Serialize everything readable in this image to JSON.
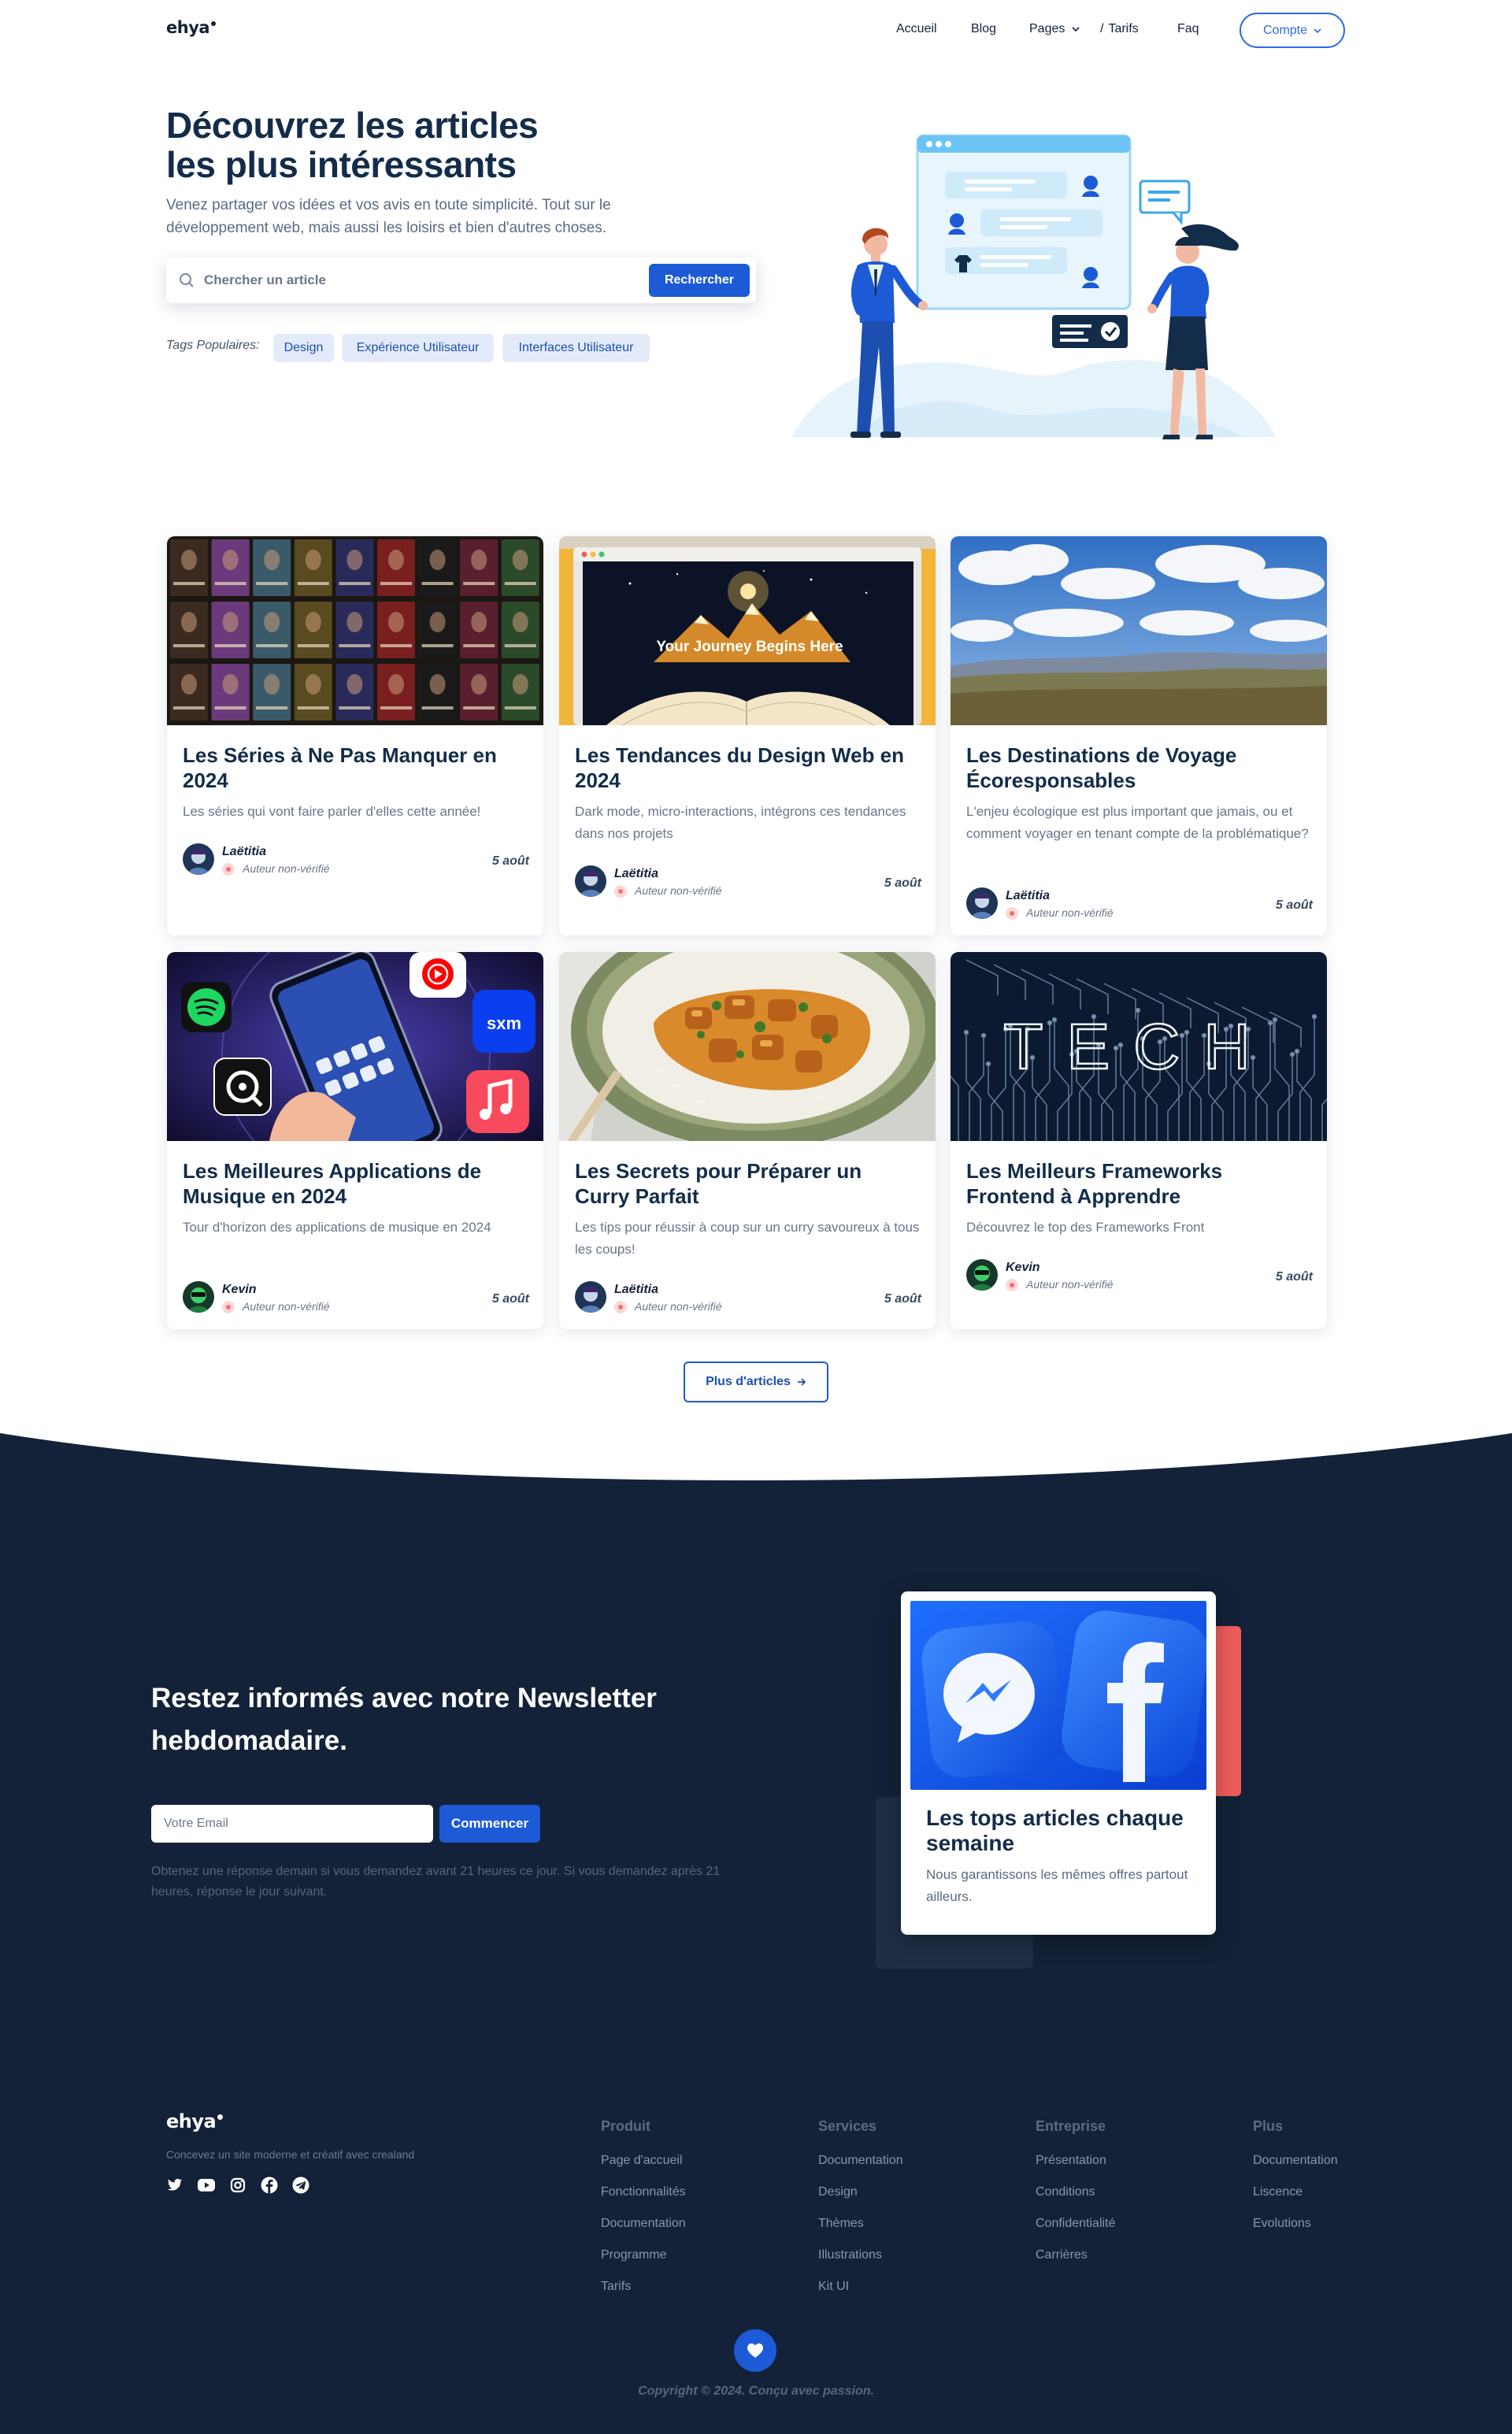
{
  "brand": {
    "name": "ehya"
  },
  "nav": {
    "links": [
      "Accueil",
      "Blog",
      "Pages",
      "Tarifs",
      "Faq"
    ],
    "account_label": "Compte"
  },
  "hero": {
    "title_line1": "Découvrez les articles",
    "title_line2": "les plus intéressants",
    "subtitle": "Venez partager vos idées et vos avis en toute simplicité. Tout sur le développement web, mais aussi les loisirs et bien d'autres choses.",
    "search_placeholder": "Chercher un article",
    "search_button": "Rechercher",
    "tags_label": "Tags Populaires:",
    "tags": [
      "Design",
      "Expérience Utilisateur",
      "Interfaces Utilisateur"
    ]
  },
  "articles": [
    {
      "title": "Les Séries à Ne Pas Manquer en 2024",
      "description": "Les séries qui vont faire parler d'elles cette année!",
      "author": "Laëtitia",
      "author_status": "Auteur non-vérifié",
      "date": "5 août",
      "image": "tv-series-posters"
    },
    {
      "title": "Les Tendances du Design Web en 2024",
      "description": "Dark mode, micro-interactions, intégrons ces tendances dans nos projets",
      "author": "Laëtitia",
      "author_status": "Auteur non-vérifié",
      "date": "5 août",
      "image": "browser-book-mountain",
      "image_caption": "Your Journey Begins Here"
    },
    {
      "title": "Les Destinations de Voyage Écoresponsables",
      "description": "L'enjeu écologique est plus important que jamais, ou et comment voyager en tenant compte de la problématique?",
      "author": "Laëtitia",
      "author_status": "Auteur non-vérifié",
      "date": "5 août",
      "image": "cloudy-landscape"
    },
    {
      "title": "Les Meilleures Applications de Musique en 2024",
      "description": "Tour d'horizon des applications de musique en 2024",
      "author": "Kevin",
      "author_status": "Auteur non-vérifié",
      "date": "5 août",
      "image": "phone-music-apps"
    },
    {
      "title": "Les Secrets pour Préparer un Curry Parfait",
      "description": "Les tips pour réussir à coup sur un curry savoureux à tous les coups!",
      "author": "Laëtitia",
      "author_status": "Auteur non-vérifié",
      "date": "5 août",
      "image": "curry-bowl"
    },
    {
      "title": "Les Meilleurs Frameworks Frontend à Apprendre",
      "description": "Découvrez le top des Frameworks Front",
      "author": "Kevin",
      "author_status": "Auteur non-vérifié",
      "date": "5 août",
      "image": "circuit-board",
      "image_caption": "TECH"
    }
  ],
  "more_button": "Plus d'articles",
  "newsletter": {
    "title": "Restez informés avec notre Newsletter hebdomadaire.",
    "email_placeholder": "Votre Email",
    "button": "Commencer",
    "note": "Obtenez une réponse demain si vous demandez avant 21 heures ce jour. Si vous demandez après 21 heures, réponse le jour suivant.",
    "card_title": "Les tops articles chaque semaine",
    "card_description": "Nous garantissons les mêmes offres partout ailleurs."
  },
  "footer": {
    "tagline": "Concevez un site moderne et créatif avec crealand",
    "social_icons": [
      "twitter-icon",
      "youtube-icon",
      "instagram-icon",
      "facebook-icon",
      "telegram-icon"
    ],
    "columns": [
      {
        "title": "Produit",
        "links": [
          "Page d'accueil",
          "Fonctionnalités",
          "Documentation",
          "Programme",
          "Tarifs"
        ]
      },
      {
        "title": "Services",
        "links": [
          "Documentation",
          "Design",
          "Thèmes",
          "Illustrations",
          "Kit UI"
        ]
      },
      {
        "title": "Entreprise",
        "links": [
          "Présentation",
          "Conditions",
          "Confidentialité",
          "Carrières"
        ]
      },
      {
        "title": "Plus",
        "links": [
          "Documentation",
          "Liscence",
          "Evolutions"
        ]
      }
    ],
    "copyright": "Copyright © 2024. Conçu avec passion."
  },
  "colors": {
    "primary": "#1d5ad6",
    "dark_bg": "#132238",
    "heading": "#132c4a",
    "accent_red": "#f05d5d"
  }
}
